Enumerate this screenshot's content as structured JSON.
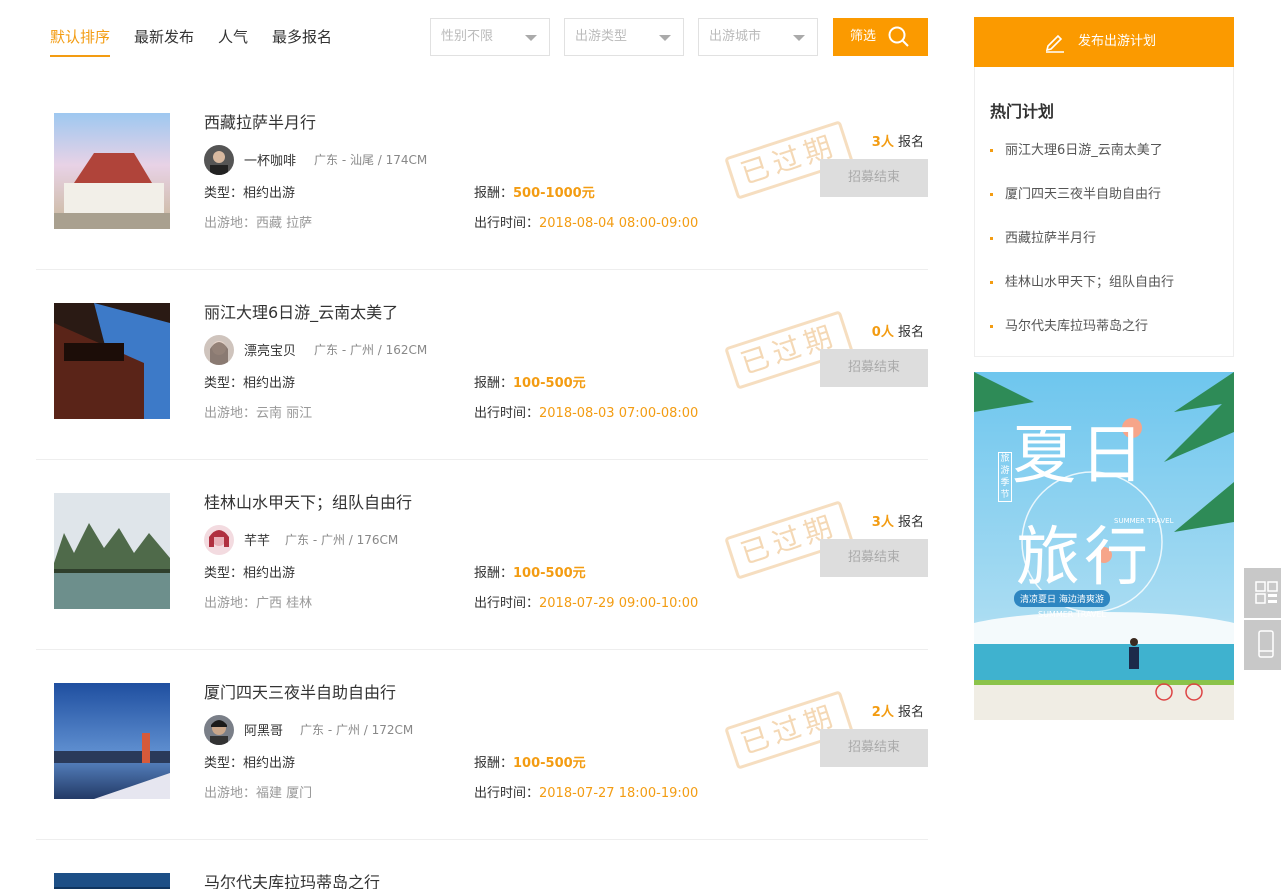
{
  "sort_tabs": [
    "默认排序",
    "最新发布",
    "人气",
    "最多报名"
  ],
  "filters": {
    "gender": "性别不限",
    "trip_type": "出游类型",
    "city": "出游城市",
    "button": "筛选"
  },
  "labels": {
    "signup": "报名",
    "type": "类型：",
    "pay": "报酬：",
    "place": "出游地：",
    "time": "出行时间：",
    "closed": "招募结束",
    "expired": "已过期"
  },
  "trips": [
    {
      "title": "西藏拉萨半月行",
      "user": "一杯咖啡",
      "info": "广东 - 汕尾 / 174CM",
      "count": "3人",
      "type": "相约出游",
      "pay": "500-1000元",
      "place": "西藏 拉萨",
      "time": "2018-08-04 08:00-09:00"
    },
    {
      "title": "丽江大理6日游_云南太美了",
      "user": "漂亮宝贝",
      "info": "广东 - 广州 / 162CM",
      "count": "0人",
      "type": "相约出游",
      "pay": "100-500元",
      "place": "云南 丽江",
      "time": "2018-08-03 07:00-08:00"
    },
    {
      "title": "桂林山水甲天下；组队自由行",
      "user": "芊芊",
      "info": "广东 - 广州 / 176CM",
      "count": "3人",
      "type": "相约出游",
      "pay": "100-500元",
      "place": "广西 桂林",
      "time": "2018-07-29 09:00-10:00"
    },
    {
      "title": "厦门四天三夜半自助自由行",
      "user": "阿黑哥",
      "info": "广东 - 广州 / 172CM",
      "count": "2人",
      "type": "相约出游",
      "pay": "100-500元",
      "place": "福建 厦门",
      "time": "2018-07-27 18:00-19:00"
    },
    {
      "title": "马尔代夫库拉玛蒂岛之行"
    }
  ],
  "sidebar": {
    "publish": "发布出游计划",
    "hot_title": "热门计划",
    "hot_items": [
      "丽江大理6日游_云南太美了",
      "厦门四天三夜半自助自由行",
      "西藏拉萨半月行",
      "桂林山水甲天下；组队自由行",
      "马尔代夫库拉玛蒂岛之行"
    ],
    "banner": {
      "line1": "夏日",
      "line2": "旅行",
      "vertical": "旅游季节",
      "small": "SUMMER TRAVEL",
      "slogan": "清凉夏日 海边清爽游",
      "footer": "SUMMER TRAVEL"
    }
  },
  "colors": {
    "accent": "#fb9a00",
    "text": "#333333"
  }
}
